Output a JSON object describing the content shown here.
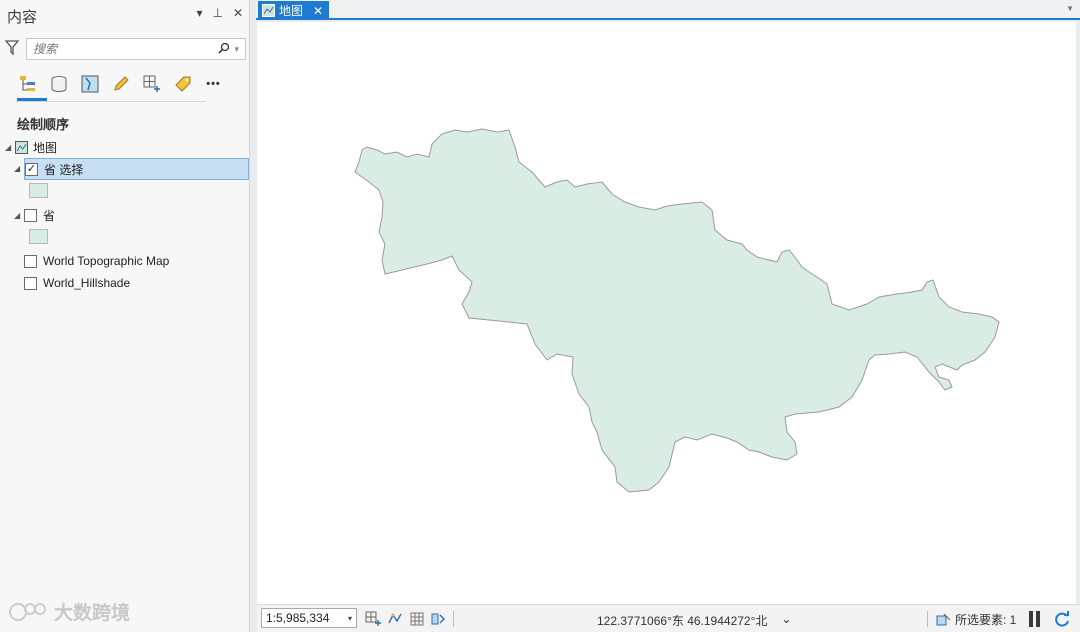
{
  "pane": {
    "title": "内容",
    "controls": {
      "menu": "▾",
      "pin": "⊥",
      "close": "✕"
    },
    "search_placeholder": "搜索",
    "heading": "绘制顺序",
    "more_label": "•••",
    "tree": {
      "map_label": "地图",
      "layer_selected": "省 选择",
      "layer_province": "省",
      "basemap1": "World Topographic Map",
      "basemap2": "World_Hillshade"
    },
    "colors": {
      "swatch": "#d8ece4",
      "accent": "#1f7bd1"
    }
  },
  "map": {
    "tab_label": "地图",
    "fill_color": "#d9ede5",
    "stroke_color": "#9a9a9a"
  },
  "status": {
    "scale": "1:5,985,334",
    "coordinates": "122.3771066°东 46.1944272°北",
    "selected_features": "所选要素: 1"
  },
  "watermark": "大数跨境"
}
